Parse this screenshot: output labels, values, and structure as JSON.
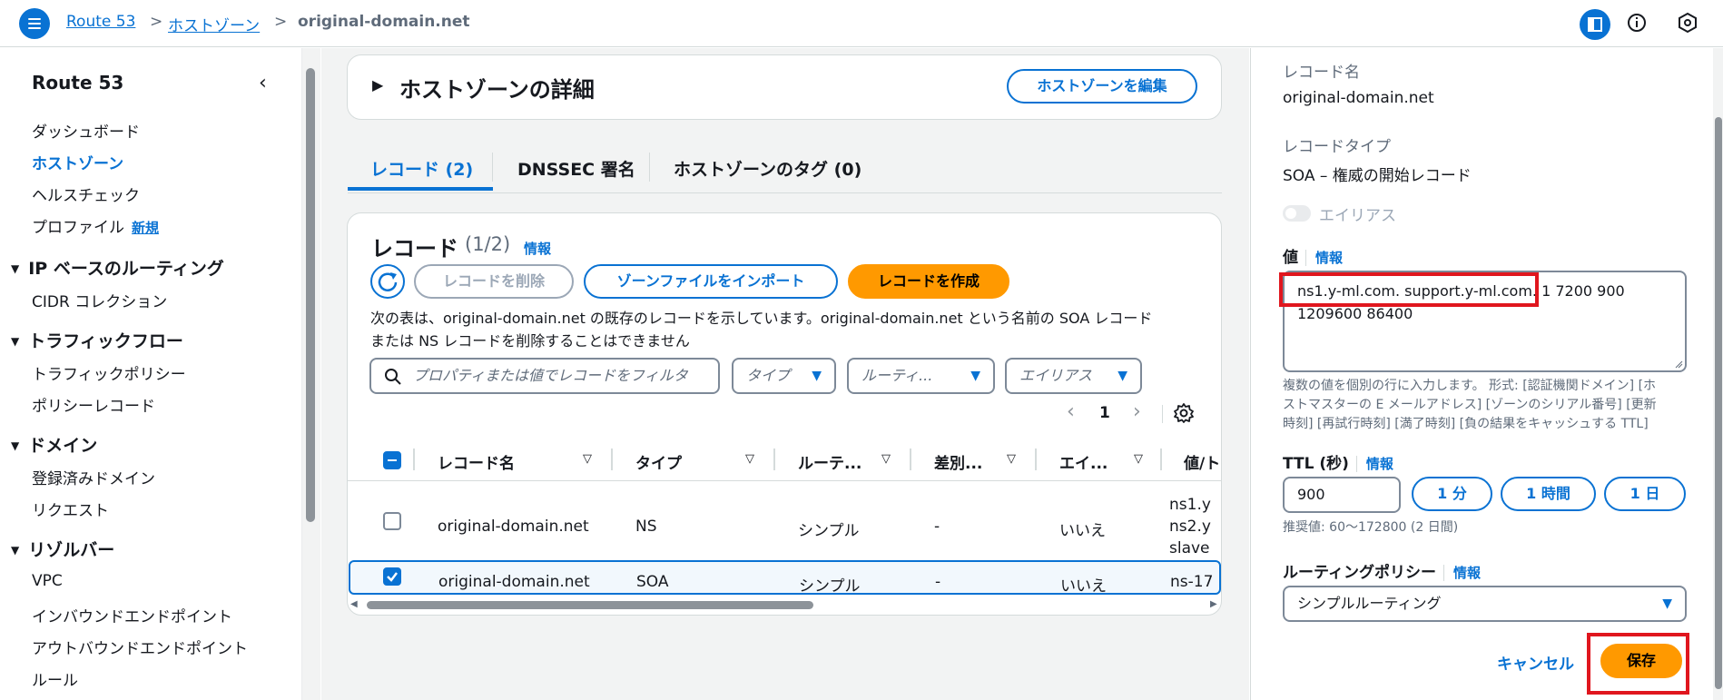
{
  "breadcrumb": {
    "root": "Route 53",
    "zones": "ホストゾーン",
    "current": "original-domain.net",
    "sep": ">"
  },
  "nav": {
    "title": "Route 53",
    "items": {
      "dashboard": "ダッシュボード",
      "hosted_zones": "ホストゾーン",
      "health_checks": "ヘルスチェック",
      "profiles": "プロファイル",
      "new_badge": "新規"
    },
    "sec_ip": "IP ベースのルーティング",
    "cidr": "CIDR コレクション",
    "sec_traffic": "トラフィックフロー",
    "traffic_policy": "トラフィックポリシー",
    "policy_record": "ポリシーレコード",
    "sec_domain": "ドメイン",
    "registered": "登録済みドメイン",
    "requests": "リクエスト",
    "sec_resolver": "リゾルバー",
    "vpc": "VPC",
    "inbound": "インバウンドエンドポイント",
    "outbound": "アウトバウンドエンドポイント",
    "rules": "ルール"
  },
  "zone_details": {
    "title": "ホストゾーンの詳細",
    "edit_button": "ホストゾーンを編集"
  },
  "tabs": {
    "records": "レコード (2)",
    "dnssec": "DNSSEC 署名",
    "tags": "ホストゾーンのタグ (0)"
  },
  "records": {
    "title": "レコード",
    "count": "(1/2)",
    "info": "情報",
    "delete_button": "レコードを削除",
    "import_button": "ゾーンファイルをインポート",
    "create_button": "レコードを作成",
    "note_line1": "次の表は、original-domain.net の既存のレコードを示しています。original-domain.net という名前の SOA レコード",
    "note_line2": "または NS レコードを削除することはできません",
    "search_placeholder": "プロパティまたは値でレコードをフィルタ",
    "filter_type": "タイプ",
    "filter_routing": "ルーティ...",
    "filter_alias": "エイリアス",
    "page": "1",
    "columns": {
      "name": "レコード名",
      "type": "タイプ",
      "routing": "ルーテ...",
      "diff": "差別...",
      "alias": "エイ...",
      "value": "値/ト"
    },
    "rows": [
      {
        "name": "original-domain.net",
        "type": "NS",
        "routing": "シンプル",
        "diff": "-",
        "alias": "いいえ",
        "value1": "ns1.y",
        "value2": "ns2.y",
        "value3": "slave"
      },
      {
        "name": "original-domain.net",
        "type": "SOA",
        "routing": "シンプル",
        "diff": "-",
        "alias": "いいえ",
        "value1": "ns-17"
      }
    ]
  },
  "editor": {
    "record_name_label": "レコード名",
    "record_name": "original-domain.net",
    "record_type_label": "レコードタイプ",
    "record_type": "SOA – 権威の開始レコード",
    "alias_label": "エイリアス",
    "value_label": "値",
    "value_info": "情報",
    "value_line1": "ns1.y-ml.com. support.y-ml.com. 1 7200 900",
    "value_line2": "1209600 86400",
    "value_hint1": "複数の値を個別の行に入力します。 形式: [認証機関ドメイン] [ホ",
    "value_hint2": "ストマスターの E メールアドレス] [ゾーンのシリアル番号] [更新",
    "value_hint3": "時刻] [再試行時刻] [満了時刻] [負の結果をキャッシュする TTL]",
    "ttl_label": "TTL (秒)",
    "ttl_info": "情報",
    "ttl_value": "900",
    "ttl_1min": "1 分",
    "ttl_1hour": "1 時間",
    "ttl_1day": "1 日",
    "ttl_hint": "推奨値: 60～172800 (2 日間)",
    "routing_label": "ルーティングポリシー",
    "routing_info": "情報",
    "routing_value": "シンプルルーティング",
    "cancel": "キャンセル",
    "save": "保存"
  },
  "colors": {
    "accent": "#0972d3",
    "primary": "#ff9900",
    "highlight": "#e0161e"
  }
}
